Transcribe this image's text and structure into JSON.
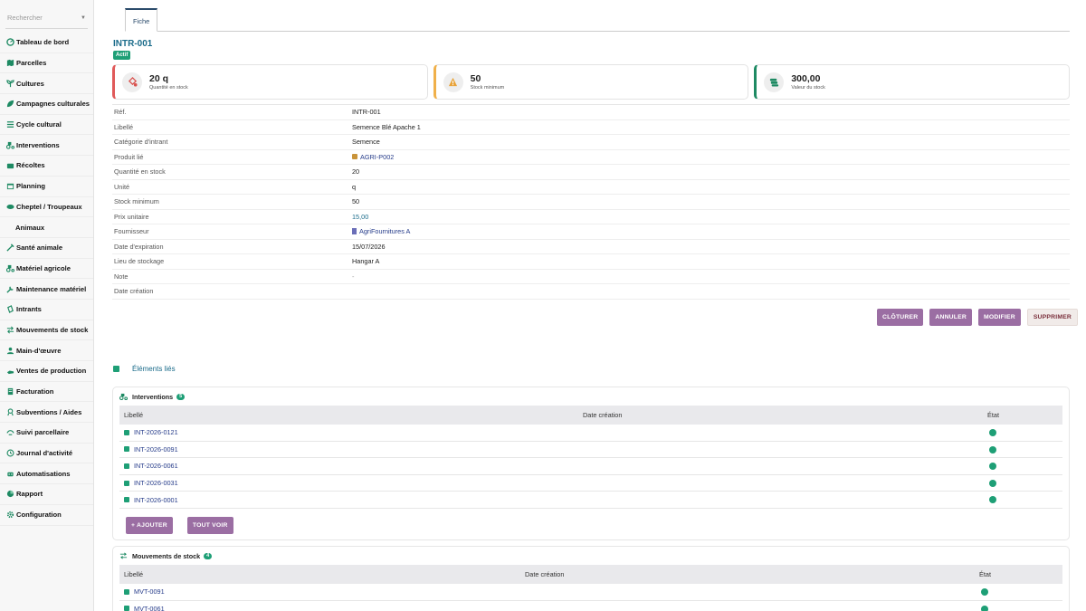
{
  "search": {
    "placeholder": "Rechercher"
  },
  "sidebar": {
    "items": [
      {
        "label": "Tableau de bord",
        "icon": "dashboard-icon"
      },
      {
        "label": "Parcelles",
        "icon": "map-icon"
      },
      {
        "label": "Cultures",
        "icon": "seedling-icon"
      },
      {
        "label": "Campagnes culturales",
        "icon": "leaf-icon"
      },
      {
        "label": "Cycle cultural",
        "icon": "list-icon"
      },
      {
        "label": "Interventions",
        "icon": "tractor-icon"
      },
      {
        "label": "Récoltes",
        "icon": "basket-icon"
      },
      {
        "label": "Planning",
        "icon": "calendar-icon"
      },
      {
        "label": "Cheptel / Troupeaux",
        "icon": "cow-icon"
      },
      {
        "label": "Animaux",
        "icon": ""
      },
      {
        "label": "Santé animale",
        "icon": "syringe-icon"
      },
      {
        "label": "Matériel agricole",
        "icon": "tractor-icon"
      },
      {
        "label": "Maintenance matériel",
        "icon": "wrench-icon"
      },
      {
        "label": "Intrants",
        "icon": "fertilizer-icon"
      },
      {
        "label": "Mouvements de stock",
        "icon": "exchange-icon"
      },
      {
        "label": "Main-d'œuvre",
        "icon": "worker-icon"
      },
      {
        "label": "Ventes de production",
        "icon": "hand-icon"
      },
      {
        "label": "Facturation",
        "icon": "invoice-icon"
      },
      {
        "label": "Subventions / Aides",
        "icon": "award-icon"
      },
      {
        "label": "Suivi parcellaire",
        "icon": "tracking-icon"
      },
      {
        "label": "Journal d'activité",
        "icon": "history-icon"
      },
      {
        "label": "Automatisations",
        "icon": "robot-icon"
      },
      {
        "label": "Rapport",
        "icon": "report-icon"
      },
      {
        "label": "Configuration",
        "icon": "gear-icon"
      }
    ]
  },
  "tabs": {
    "fiche": "Fiche"
  },
  "record": {
    "ref": "INTR-001",
    "status": "Actif"
  },
  "kpis": [
    {
      "value": "20 q",
      "label": "Quantité en stock",
      "color": "#e05a5a",
      "icon": "low-stock-icon"
    },
    {
      "value": "50",
      "label": "Stock minimum",
      "color": "#f0b04a",
      "icon": "warning-icon"
    },
    {
      "value": "300,00",
      "label": "Valeur du stock",
      "color": "#1e8a63",
      "icon": "money-icon"
    }
  ],
  "details": [
    {
      "key": "Réf.",
      "value": "INTR-001"
    },
    {
      "key": "Libellé",
      "value": "Semence Blé Apache 1"
    },
    {
      "key": "Catégorie d'intrant",
      "value": "Semence"
    },
    {
      "key": "Produit lié",
      "value": "AGRI-P002"
    },
    {
      "key": "Quantité en stock",
      "value": "20"
    },
    {
      "key": "Unité",
      "value": "q"
    },
    {
      "key": "Stock minimum",
      "value": "50"
    },
    {
      "key": "Prix unitaire",
      "value": "15,00"
    },
    {
      "key": "Fournisseur",
      "value": "AgriFournitures A"
    },
    {
      "key": "Date d'expiration",
      "value": "15/07/2026"
    },
    {
      "key": "Lieu de stockage",
      "value": "Hangar A"
    },
    {
      "key": "Note",
      "value": "-"
    },
    {
      "key": "Date création",
      "value": ""
    }
  ],
  "actions": {
    "close": "CLÔTURER",
    "cancel": "ANNULER",
    "edit": "MODIFIER",
    "delete": "SUPPRIMER"
  },
  "linked": {
    "title": "Éléments liés"
  },
  "interventions": {
    "title": "Interventions",
    "count": "5",
    "columns": {
      "label": "Libellé",
      "date": "Date création",
      "state": "État"
    },
    "rows": [
      "INT-2026-0121",
      "INT-2026-0091",
      "INT-2026-0061",
      "INT-2026-0031",
      "INT-2026-0001"
    ],
    "add": "+ AJOUTER",
    "see_all": "TOUT VOIR"
  },
  "movements": {
    "title": "Mouvements de stock",
    "count": "4",
    "columns": {
      "label": "Libellé",
      "date": "Date création",
      "state": "État"
    },
    "rows": [
      "MVT-0091",
      "MVT-0061"
    ]
  }
}
